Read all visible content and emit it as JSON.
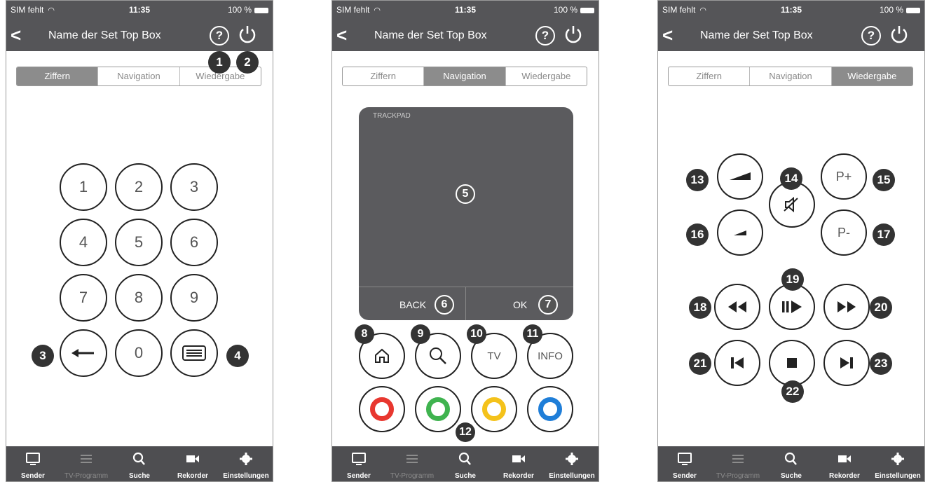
{
  "status": {
    "carrier": "SIM fehlt",
    "time": "11:35",
    "battery": "100 %"
  },
  "header": {
    "title": "Name der Set Top Box"
  },
  "segments": [
    "Ziffern",
    "Navigation",
    "Wiedergabe"
  ],
  "keypad": [
    "1",
    "2",
    "3",
    "4",
    "5",
    "6",
    "7",
    "8",
    "9",
    "0"
  ],
  "trackpad": {
    "label": "TRACKPAD",
    "back": "BACK",
    "ok": "OK"
  },
  "nav_buttons": {
    "tv": "TV",
    "info": "INFO"
  },
  "playback": {
    "p_plus": "P+",
    "p_minus": "P-"
  },
  "color_keys": [
    "#e8372f",
    "#3fb34f",
    "#f4c21b",
    "#1f7ed8"
  ],
  "tabs": [
    "Sender",
    "TV-Programm",
    "Suche",
    "Rekorder",
    "Einstellungen"
  ],
  "callouts": [
    "1",
    "2",
    "3",
    "4",
    "5",
    "6",
    "7",
    "8",
    "9",
    "10",
    "11",
    "12",
    "13",
    "14",
    "15",
    "16",
    "17",
    "18",
    "19",
    "20",
    "21",
    "22",
    "23"
  ]
}
